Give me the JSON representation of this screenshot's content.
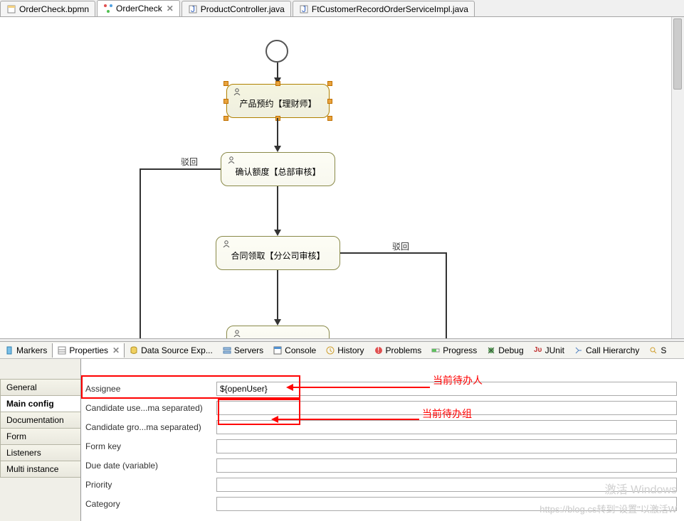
{
  "editorTabs": [
    {
      "label": "OrderCheck.bpmn",
      "icon": "file-icon",
      "active": false
    },
    {
      "label": "OrderCheck",
      "icon": "diagram-icon",
      "active": true,
      "closeable": true
    },
    {
      "label": "ProductController.java",
      "icon": "java-icon",
      "active": false
    },
    {
      "label": "FtCustomerRecordOrderServiceImpl.java",
      "icon": "java-icon",
      "active": false
    }
  ],
  "diagram": {
    "task1": "产品预约【理财师】",
    "task2": "确认额度【总部审核】",
    "task3": "合同领取【分公司审核】",
    "label_reject": "驳回"
  },
  "views": [
    {
      "label": "Markers",
      "icon": "markers-icon"
    },
    {
      "label": "Properties",
      "icon": "props-icon",
      "active": true,
      "closeable": true
    },
    {
      "label": "Data Source Exp...",
      "icon": "datasource-icon"
    },
    {
      "label": "Servers",
      "icon": "servers-icon"
    },
    {
      "label": "Console",
      "icon": "console-icon"
    },
    {
      "label": "History",
      "icon": "history-icon"
    },
    {
      "label": "Problems",
      "icon": "problems-icon"
    },
    {
      "label": "Progress",
      "icon": "progress-icon"
    },
    {
      "label": "Debug",
      "icon": "debug-icon"
    },
    {
      "label": "JUnit",
      "icon": "junit-icon"
    },
    {
      "label": "Call Hierarchy",
      "icon": "callh-icon"
    },
    {
      "label": "S",
      "icon": "search-icon"
    }
  ],
  "sideTabs": [
    {
      "label": "General"
    },
    {
      "label": "Main config",
      "active": true
    },
    {
      "label": "Documentation"
    },
    {
      "label": "Form"
    },
    {
      "label": "Listeners"
    },
    {
      "label": "Multi instance"
    }
  ],
  "form": {
    "assignee_label": "Assignee",
    "assignee_value": "${openUser}",
    "cand_users_label": "Candidate use...ma separated)",
    "cand_users_value": "",
    "cand_groups_label": "Candidate gro...ma separated)",
    "cand_groups_value": "",
    "form_key_label": "Form key",
    "form_key_value": "",
    "due_date_label": "Due date (variable)",
    "due_date_value": "",
    "priority_label": "Priority",
    "priority_value": "",
    "category_label": "Category",
    "category_value": ""
  },
  "annotations": {
    "assignee_note": "当前待办人",
    "groups_note": "当前待办组"
  },
  "watermark": {
    "line1": "激活 Windows",
    "line2": "https://blog.cs转到\"设置\"以激活W"
  }
}
